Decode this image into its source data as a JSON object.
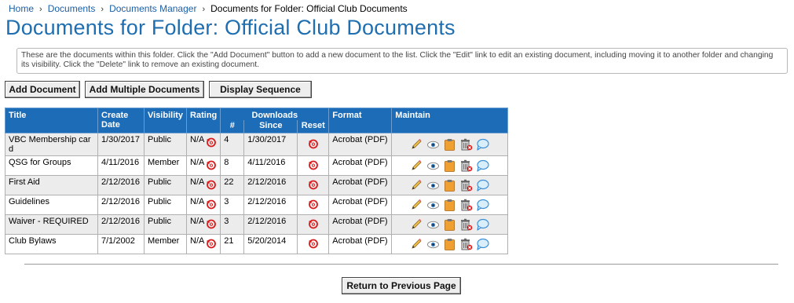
{
  "breadcrumb": {
    "home": "Home",
    "documents": "Documents",
    "manager": "Documents Manager",
    "current": "Documents for Folder: Official Club Documents"
  },
  "page_title": "Documents for Folder: Official Club Documents",
  "info_text": "These are the documents within this folder. Click the \"Add Document\" button to add a new document to the list. Click the \"Edit\" link to edit an existing document, including moving it to another folder and changing its visibility. Click the \"Delete\" link to remove an existing document.",
  "buttons": {
    "add_document": "Add Document",
    "add_multiple": "Add Multiple Documents",
    "display_sequence": "Display Sequence",
    "return": "Return to Previous Page"
  },
  "table": {
    "headers": {
      "title": "Title",
      "create": "Create",
      "date": "Date",
      "visibility": "Visibility",
      "rating": "Rating",
      "downloads": "Downloads",
      "count": "#",
      "since": "Since",
      "reset": "Reset",
      "format": "Format",
      "maintain": "Maintain"
    },
    "rows": [
      {
        "title": "VBC Membership car d",
        "date": "1/30/2017",
        "visibility": "Public",
        "rating": "N/A",
        "count": "4",
        "since": "1/30/2017",
        "format": "Acrobat (PDF)"
      },
      {
        "title": "QSG for Groups",
        "date": "4/11/2016",
        "visibility": "Member",
        "rating": "N/A",
        "count": "8",
        "since": "4/11/2016",
        "format": "Acrobat (PDF)"
      },
      {
        "title": "First Aid",
        "date": "2/12/2016",
        "visibility": "Public",
        "rating": "N/A",
        "count": "22",
        "since": "2/12/2016",
        "format": "Acrobat (PDF)"
      },
      {
        "title": "Guidelines",
        "date": "2/12/2016",
        "visibility": "Public",
        "rating": "N/A",
        "count": "3",
        "since": "2/12/2016",
        "format": "Acrobat (PDF)"
      },
      {
        "title": "Waiver - REQUIRED",
        "date": "2/12/2016",
        "visibility": "Public",
        "rating": "N/A",
        "count": "3",
        "since": "2/12/2016",
        "format": "Acrobat (PDF)"
      },
      {
        "title": "Club Bylaws",
        "date": "7/1/2002",
        "visibility": "Member",
        "rating": "N/A",
        "count": "21",
        "since": "5/20/2014",
        "format": "Acrobat (PDF)"
      }
    ]
  },
  "icons": {
    "reset": "reset-icon",
    "edit": "pencil-icon",
    "view": "eye-icon",
    "clipboard": "clipboard-icon",
    "delete": "trash-icon",
    "comment": "speech-bubble-icon"
  },
  "colors": {
    "header_bg": "#1d6cb8",
    "title": "#1f6fb0",
    "link": "#1a5fa8",
    "reset_red": "#d81b1b"
  }
}
